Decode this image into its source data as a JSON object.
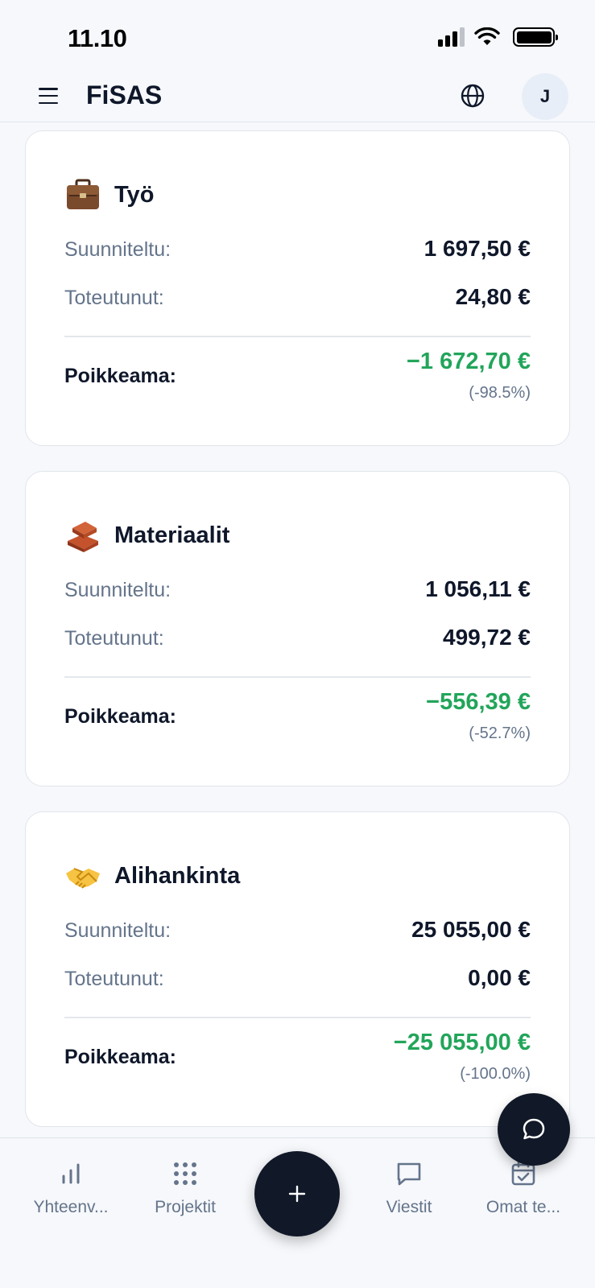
{
  "status_bar": {
    "time": "11.10"
  },
  "header": {
    "title": "FiSAS",
    "avatar_initial": "J"
  },
  "labels": {
    "planned": "Suunniteltu:",
    "actual": "Toteutunut:",
    "deviation": "Poikkeama:"
  },
  "cards": [
    {
      "icon": "briefcase-icon",
      "title": "Työ",
      "planned": "1 697,50 €",
      "actual": "24,80 €",
      "deviation": "−1 672,70 €",
      "deviation_pct": "(-98.5%)"
    },
    {
      "icon": "bricks-icon",
      "title": "Materiaalit",
      "planned": "1 056,11 €",
      "actual": "499,72 €",
      "deviation": "−556,39 €",
      "deviation_pct": "(-52.7%)"
    },
    {
      "icon": "handshake-icon",
      "title": "Alihankinta",
      "planned": "25 055,00 €",
      "actual": "0,00 €",
      "deviation": "−25 055,00 €",
      "deviation_pct": "(-100.0%)"
    }
  ],
  "bottom_nav": {
    "items": [
      {
        "icon": "bar-chart-icon",
        "label": "Yhteenv..."
      },
      {
        "icon": "grid-dots-icon",
        "label": "Projektit"
      },
      {
        "icon": "message-square-icon",
        "label": "Viestit"
      },
      {
        "icon": "calendar-check-icon",
        "label": "Omat te..."
      }
    ]
  },
  "colors": {
    "accent_dark": "#111827",
    "deviation_green": "#22a55a",
    "muted_text": "#64748b"
  }
}
